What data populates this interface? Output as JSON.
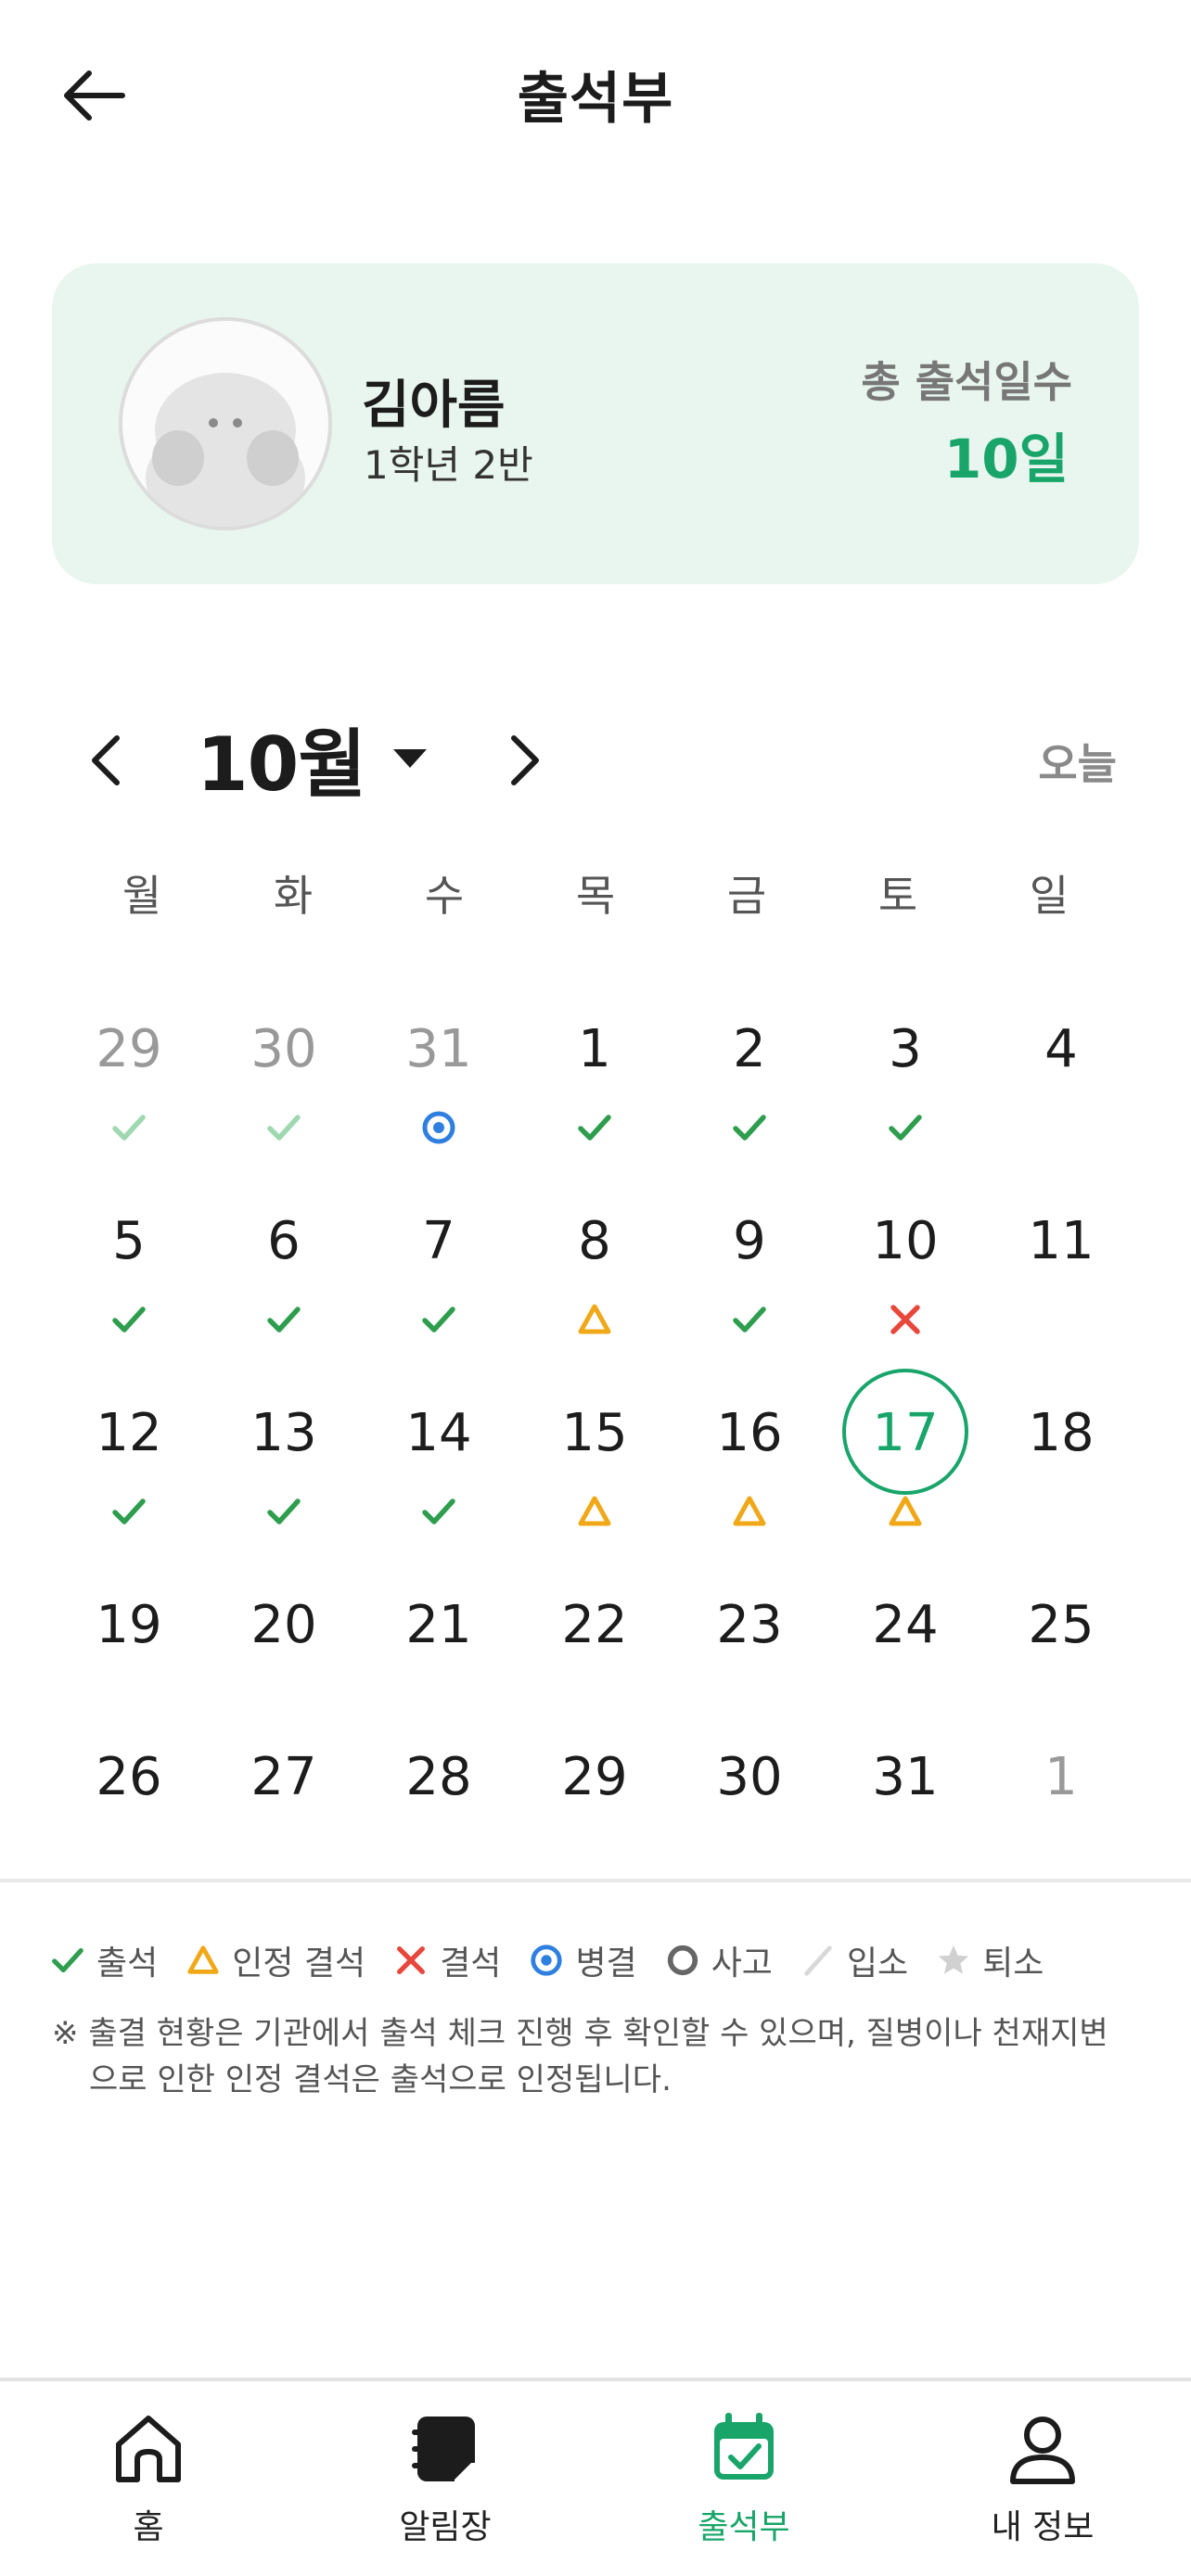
{
  "header": {
    "title": "출석부"
  },
  "profile": {
    "name": "김아름",
    "class": "1학년 2반",
    "total_label": "총 출석일수",
    "total_value": "10일"
  },
  "calendar": {
    "month_label": "10월",
    "today_label": "오늘",
    "weekdays": [
      "월",
      "화",
      "수",
      "목",
      "금",
      "토",
      "일"
    ],
    "weeks": [
      [
        {
          "d": "29",
          "muted": true,
          "status": "present-faded"
        },
        {
          "d": "30",
          "muted": true,
          "status": "present-faded"
        },
        {
          "d": "31",
          "muted": true,
          "status": "sick"
        },
        {
          "d": "1",
          "status": "present"
        },
        {
          "d": "2",
          "status": "present"
        },
        {
          "d": "3",
          "status": "present"
        },
        {
          "d": "4"
        }
      ],
      [
        {
          "d": "5",
          "status": "present"
        },
        {
          "d": "6",
          "status": "present"
        },
        {
          "d": "7",
          "status": "present"
        },
        {
          "d": "8",
          "status": "excused"
        },
        {
          "d": "9",
          "status": "present"
        },
        {
          "d": "10",
          "status": "absent"
        },
        {
          "d": "11"
        }
      ],
      [
        {
          "d": "12",
          "status": "present"
        },
        {
          "d": "13",
          "status": "present"
        },
        {
          "d": "14",
          "status": "present"
        },
        {
          "d": "15",
          "status": "excused"
        },
        {
          "d": "16",
          "status": "excused"
        },
        {
          "d": "17",
          "today": true,
          "status": "excused"
        },
        {
          "d": "18"
        }
      ],
      [
        {
          "d": "19"
        },
        {
          "d": "20"
        },
        {
          "d": "21"
        },
        {
          "d": "22"
        },
        {
          "d": "23"
        },
        {
          "d": "24"
        },
        {
          "d": "25"
        }
      ],
      [
        {
          "d": "26"
        },
        {
          "d": "27"
        },
        {
          "d": "28"
        },
        {
          "d": "29"
        },
        {
          "d": "30"
        },
        {
          "d": "31"
        },
        {
          "d": "1",
          "muted": true
        }
      ]
    ]
  },
  "legend": [
    {
      "icon": "present",
      "label": "출석"
    },
    {
      "icon": "excused",
      "label": "인정 결석"
    },
    {
      "icon": "absent",
      "label": "결석"
    },
    {
      "icon": "sick",
      "label": "병결"
    },
    {
      "icon": "incident",
      "label": "사고"
    },
    {
      "icon": "admitted",
      "label": "입소"
    },
    {
      "icon": "discharged",
      "label": "퇴소"
    }
  ],
  "notice": "※ 출결 현황은 기관에서 출석 체크 진행 후 확인할 수 있으며, 질병이나 천재지변으로 인한 인정 결석은 출석으로 인정됩니다.",
  "tabs": [
    {
      "id": "home",
      "label": "홈"
    },
    {
      "id": "notice",
      "label": "알림장"
    },
    {
      "id": "attendance",
      "label": "출석부",
      "active": true
    },
    {
      "id": "profile",
      "label": "내 정보"
    }
  ],
  "colors": {
    "accent": "#19a56a",
    "present": "#2e9e4e",
    "present_faded": "#9fd8b0",
    "excused": "#f0a818",
    "absent": "#e8473c",
    "sick": "#2f7fe0",
    "incident": "#666666",
    "admitted": "#d8d8d8",
    "discharged": "#d0d0d0",
    "card_bg": "#e8f6ef"
  }
}
